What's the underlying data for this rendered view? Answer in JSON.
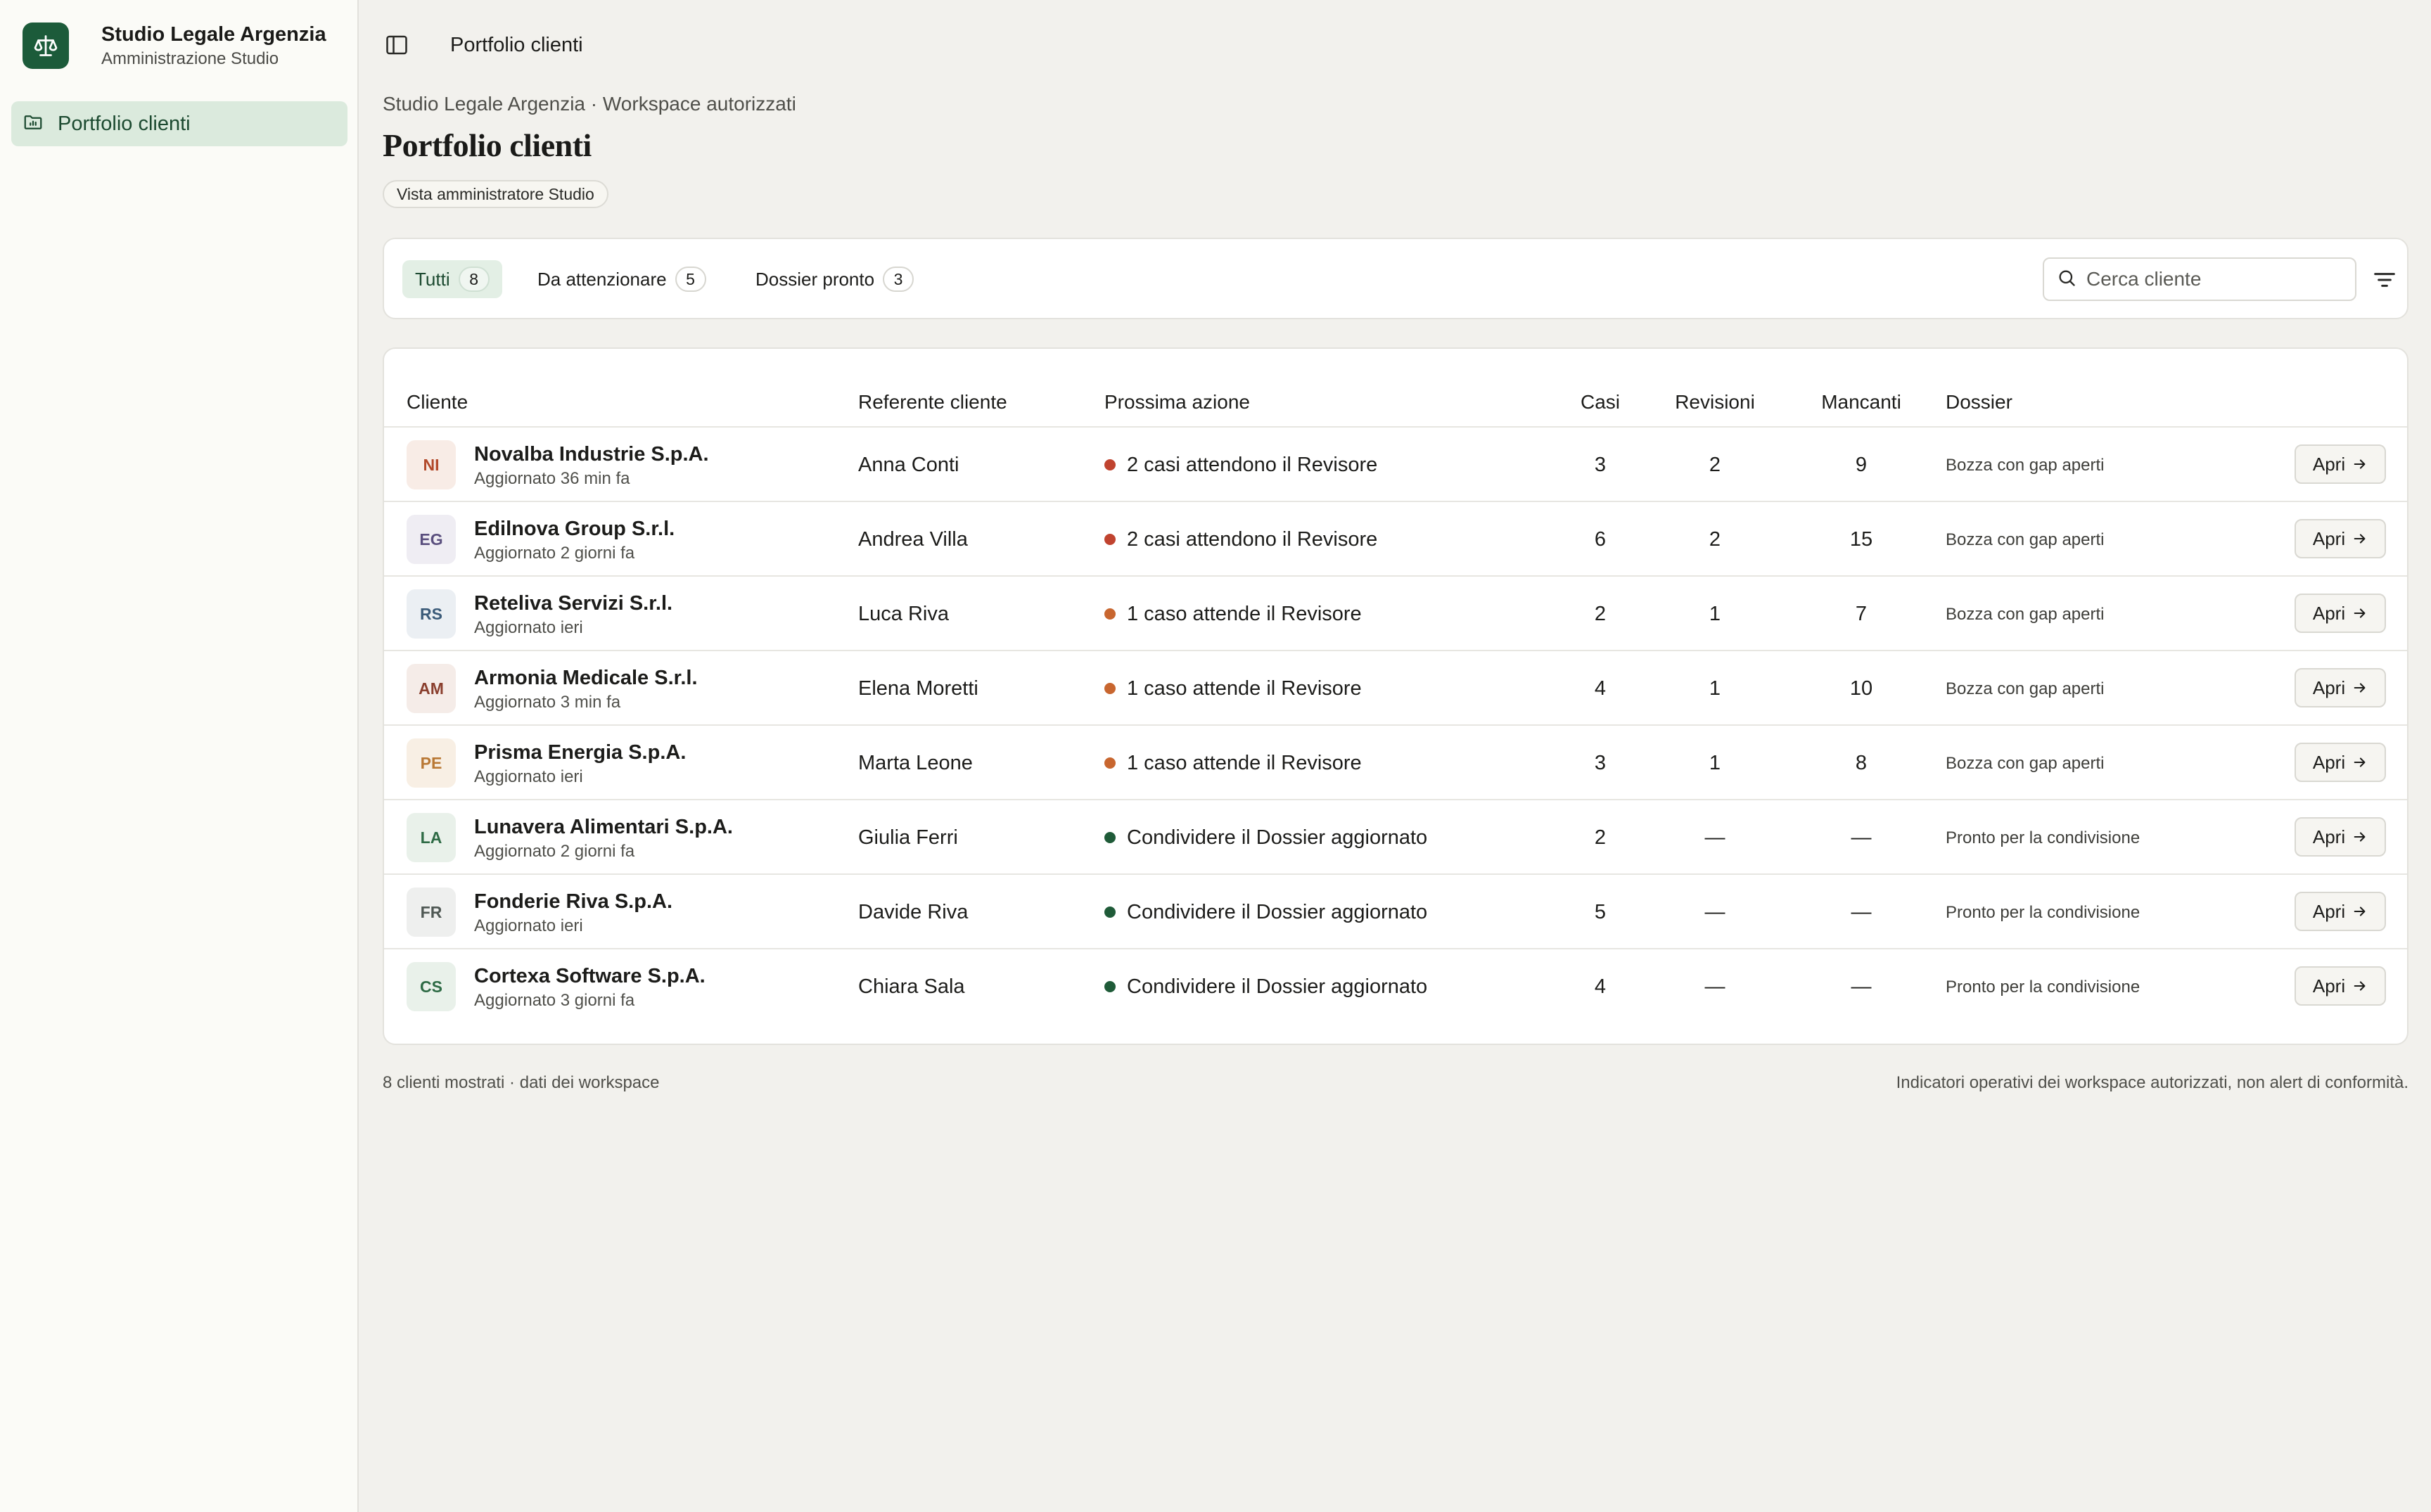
{
  "sidebar": {
    "brand_title": "Studio Legale Argenzia",
    "brand_subtitle": "Amministrazione Studio",
    "nav": [
      {
        "label": "Portfolio clienti",
        "icon": "folder-chart-icon",
        "active": true
      }
    ]
  },
  "topbar": {
    "title": "Portfolio clienti"
  },
  "header": {
    "breadcrumb": "Studio Legale Argenzia · Workspace autorizzati",
    "title": "Portfolio clienti",
    "badge": "Vista amministratore Studio"
  },
  "filters": {
    "tabs": [
      {
        "label": "Tutti",
        "count": "8",
        "active": true
      },
      {
        "label": "Da attenzionare",
        "count": "5"
      },
      {
        "label": "Dossier pronto",
        "count": "3"
      }
    ],
    "search_placeholder": "Cerca cliente"
  },
  "table": {
    "headers": {
      "cliente": "Cliente",
      "referente": "Referente cliente",
      "azione": "Prossima azione",
      "casi": "Casi",
      "revisioni": "Revisioni",
      "mancanti": "Mancanti",
      "dossier": "Dossier"
    },
    "open_label": "Apri",
    "rows": [
      {
        "initials": "NI",
        "name": "Novalba Industrie S.p.A.",
        "updated": "Aggiornato 36 min fa",
        "referente": "Anna Conti",
        "azione": "2 casi attendono il Revisore",
        "status": "red",
        "casi": "3",
        "revisioni": "2",
        "mancanti": "9",
        "dossier": "Bozza con gap aperti",
        "avatar_bg": "#f8ece6",
        "avatar_fg": "#b2492a"
      },
      {
        "initials": "EG",
        "name": "Edilnova Group S.r.l.",
        "updated": "Aggiornato 2 giorni fa",
        "referente": "Andrea Villa",
        "azione": "2 casi attendono il Revisore",
        "status": "red",
        "casi": "6",
        "revisioni": "2",
        "mancanti": "15",
        "dossier": "Bozza con gap aperti",
        "avatar_bg": "#efedf3",
        "avatar_fg": "#5a4f7e"
      },
      {
        "initials": "RS",
        "name": "Reteliva Servizi S.r.l.",
        "updated": "Aggiornato ieri",
        "referente": "Luca Riva",
        "azione": "1 caso attende il Revisore",
        "status": "orange",
        "casi": "2",
        "revisioni": "1",
        "mancanti": "7",
        "dossier": "Bozza con gap aperti",
        "avatar_bg": "#ebeff3",
        "avatar_fg": "#3a5a78"
      },
      {
        "initials": "AM",
        "name": "Armonia Medicale S.r.l.",
        "updated": "Aggiornato 3 min fa",
        "referente": "Elena Moretti",
        "azione": "1 caso attende il Revisore",
        "status": "orange",
        "casi": "4",
        "revisioni": "1",
        "mancanti": "10",
        "dossier": "Bozza con gap aperti",
        "avatar_bg": "#f5ece8",
        "avatar_fg": "#8a3f2e"
      },
      {
        "initials": "PE",
        "name": "Prisma Energia S.p.A.",
        "updated": "Aggiornato ieri",
        "referente": "Marta Leone",
        "azione": "1 caso attende il Revisore",
        "status": "orange",
        "casi": "3",
        "revisioni": "1",
        "mancanti": "8",
        "dossier": "Bozza con gap aperti",
        "avatar_bg": "#f8efe4",
        "avatar_fg": "#b97834"
      },
      {
        "initials": "LA",
        "name": "Lunavera Alimentari S.p.A.",
        "updated": "Aggiornato 2 giorni fa",
        "referente": "Giulia Ferri",
        "azione": "Condividere il Dossier aggiornato",
        "status": "green",
        "casi": "2",
        "revisioni": "—",
        "mancanti": "—",
        "dossier": "Pronto per la condivisione",
        "avatar_bg": "#e9f1ea",
        "avatar_fg": "#2e6b45"
      },
      {
        "initials": "FR",
        "name": "Fonderie Riva S.p.A.",
        "updated": "Aggiornato ieri",
        "referente": "Davide Riva",
        "azione": "Condividere il Dossier aggiornato",
        "status": "green",
        "casi": "5",
        "revisioni": "—",
        "mancanti": "—",
        "dossier": "Pronto per la condivisione",
        "avatar_bg": "#eeefee",
        "avatar_fg": "#4e5753"
      },
      {
        "initials": "CS",
        "name": "Cortexa Software S.p.A.",
        "updated": "Aggiornato 3 giorni fa",
        "referente": "Chiara Sala",
        "azione": "Condividere il Dossier aggiornato",
        "status": "green",
        "casi": "4",
        "revisioni": "—",
        "mancanti": "—",
        "dossier": "Pronto per la condivisione",
        "avatar_bg": "#e9f1ea",
        "avatar_fg": "#2e6b45"
      }
    ]
  },
  "status_colors": {
    "red": "#c0432f",
    "orange": "#c8662f",
    "green": "#1f5b38"
  },
  "footer": {
    "left": "8 clienti mostrati · dati dei workspace",
    "right": "Indicatori operativi dei workspace autorizzati, non alert di conformità."
  }
}
